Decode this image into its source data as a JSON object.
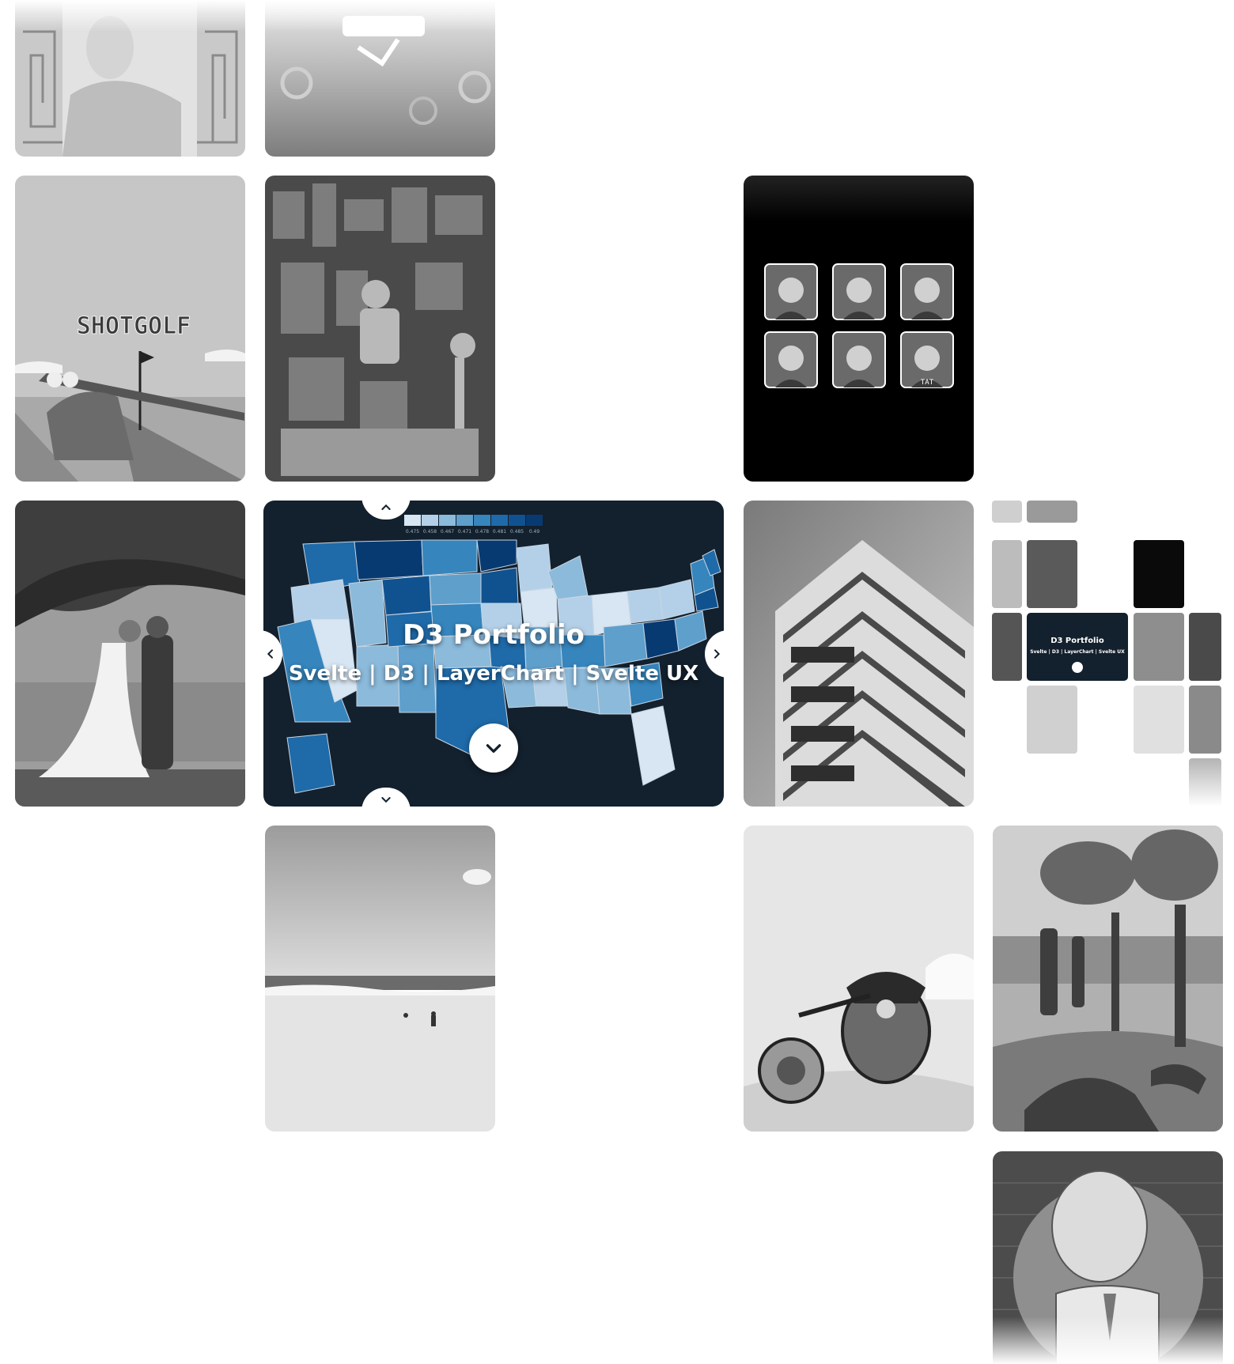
{
  "gallery": {
    "featured": {
      "title": "D3 Portfolio",
      "subtitle": "Svelte  |  D3  |  LayerChart  |  Svelte UX",
      "legend_labels": [
        "0.475",
        "0.458",
        "0.467",
        "0.471",
        "0.478",
        "0.481",
        "0.485",
        "0.49"
      ],
      "legend_colors": [
        "#d7e6f2",
        "#b3d0e8",
        "#8cbadb",
        "#5e9fcc",
        "#3685bd",
        "#1f6aa8",
        "#10528f",
        "#083a72"
      ],
      "icons": {
        "expand": "chevron-down-icon",
        "up": "chevron-up-icon",
        "down": "chevron-down-icon",
        "left": "chevron-left-icon",
        "right": "chevron-right-icon"
      }
    },
    "tiles": {
      "shotgolf_text": "SHOTGOLF",
      "shirt_text": "TAT",
      "mini_title": "D3 Portfolio",
      "mini_subtitle": "Svelte | D3 | LayerChart | Svelte UX"
    },
    "colors": {
      "background": "#ffffff",
      "featured_bg": "#13202d",
      "accent_blue": "#1f6aa8"
    }
  }
}
